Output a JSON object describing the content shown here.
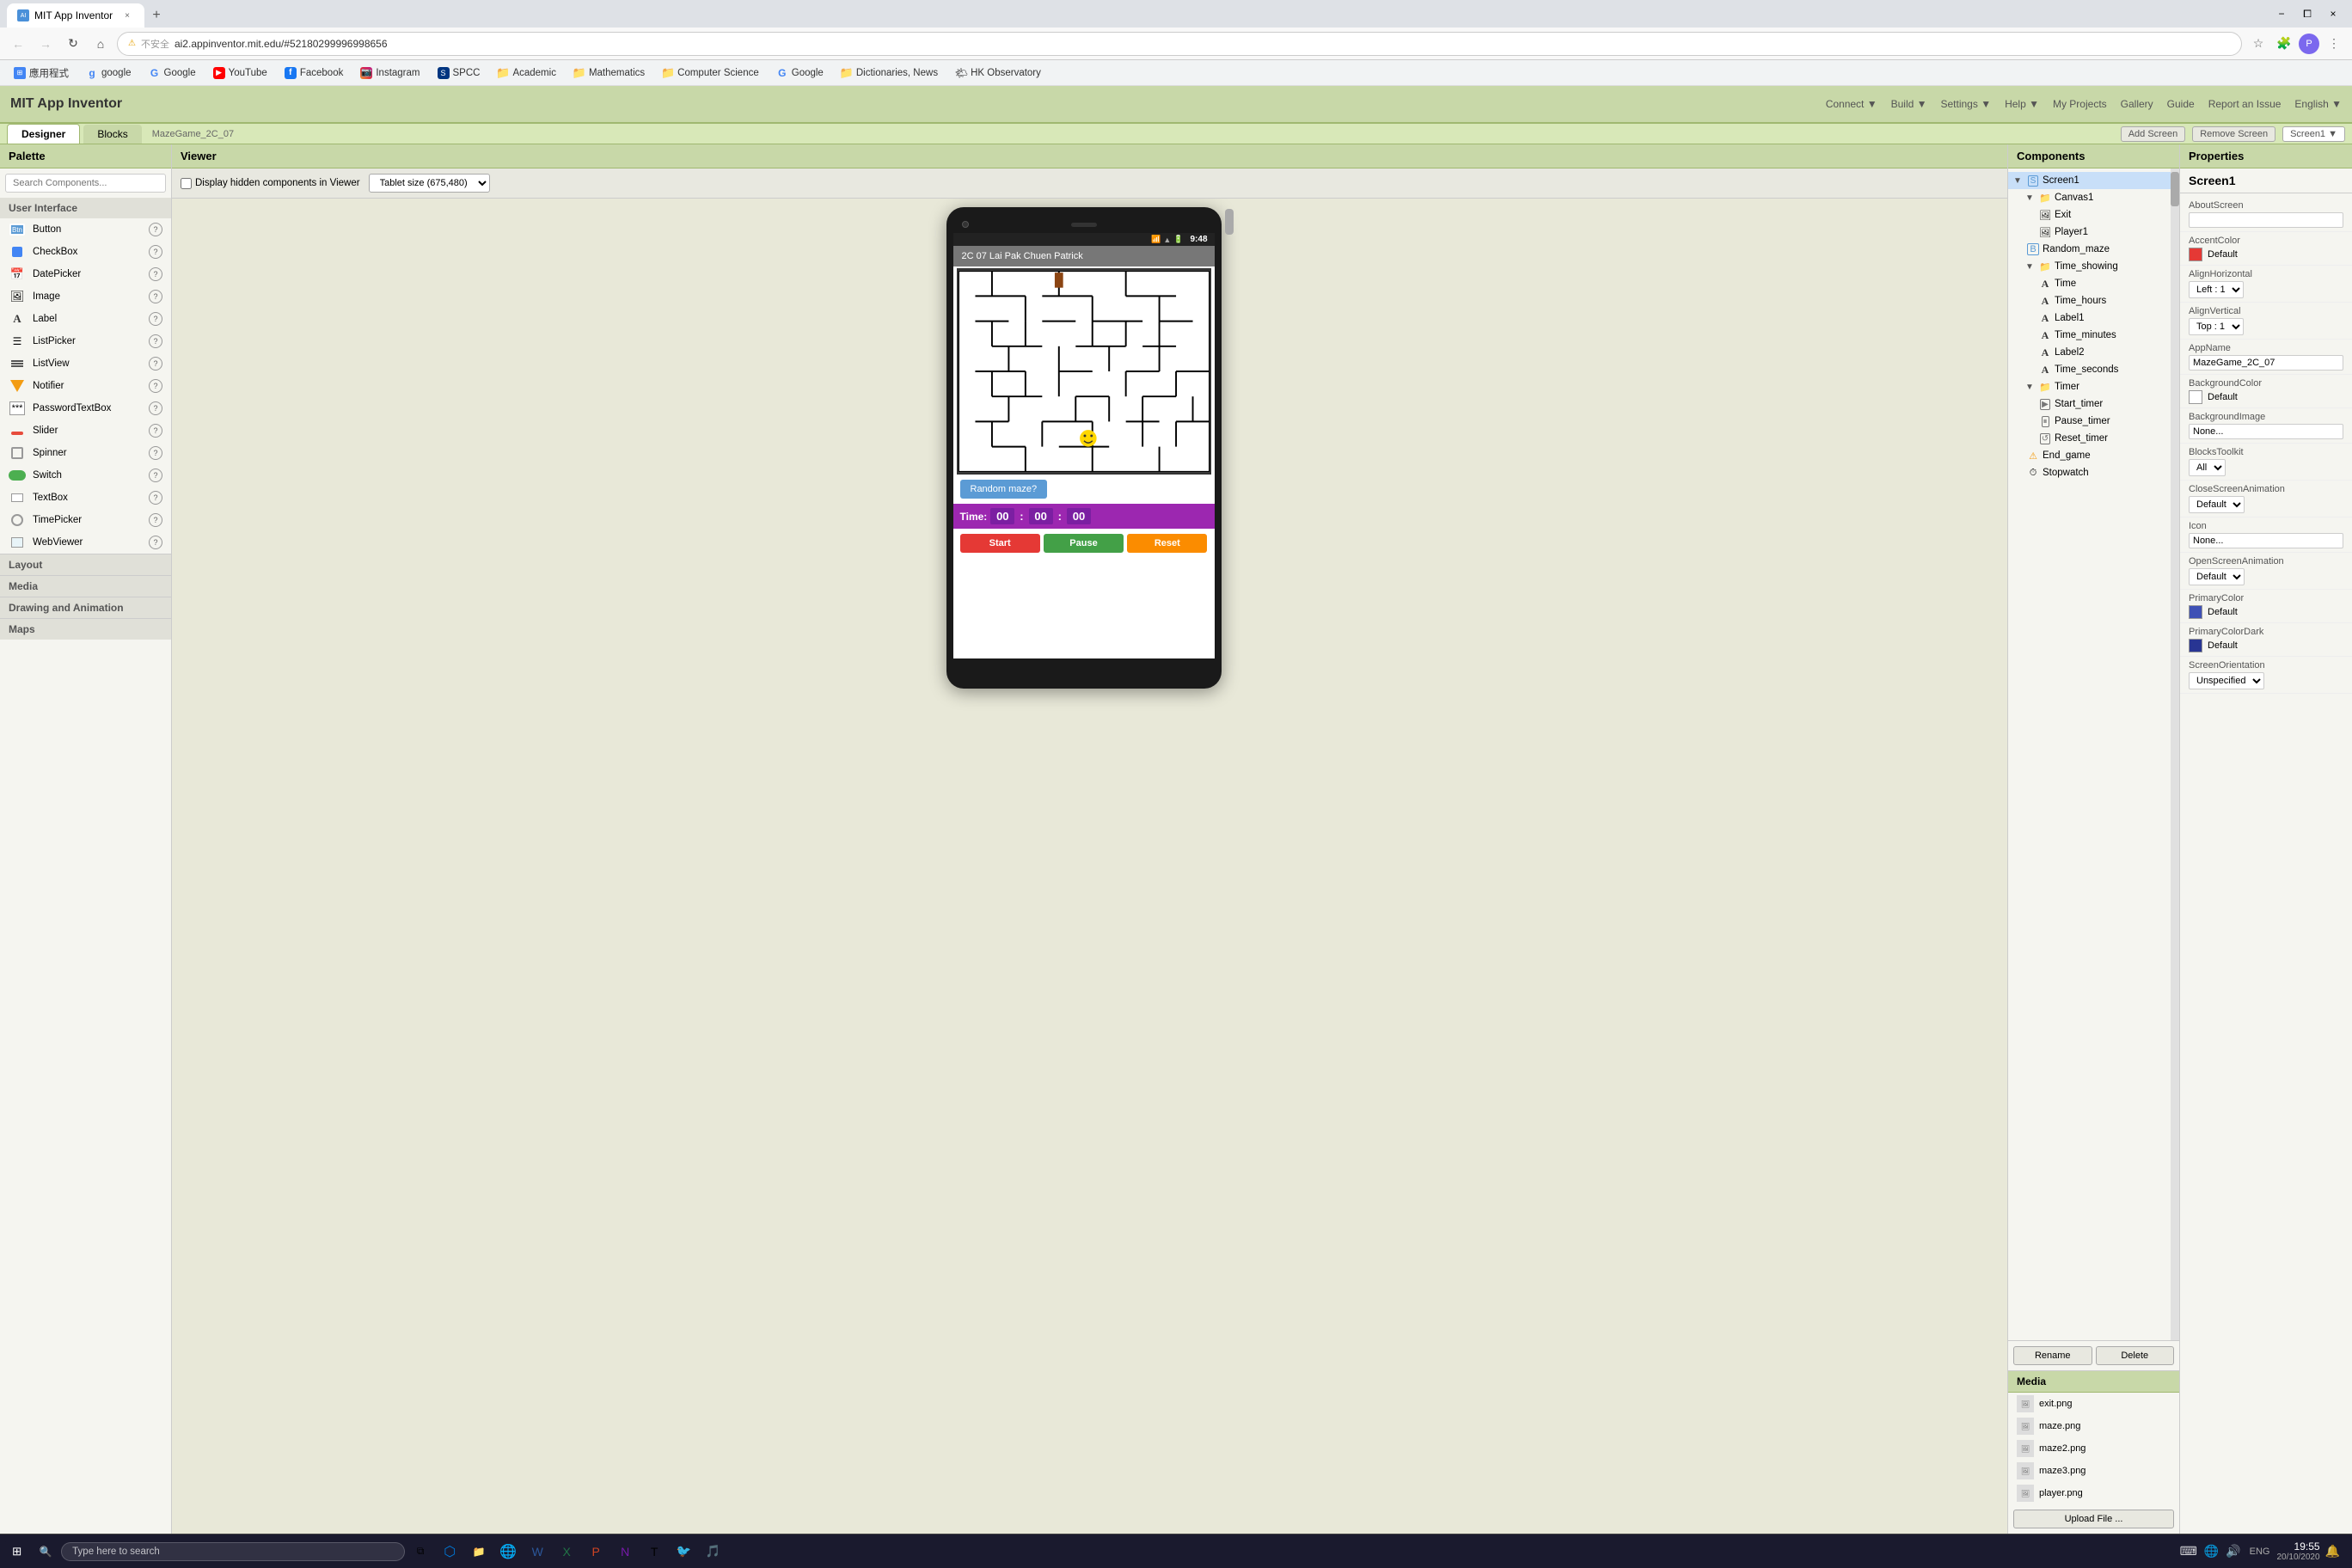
{
  "browser": {
    "tab": {
      "favicon": "MIT",
      "title": "MIT App Inventor",
      "url": "ai2.appinventor.mit.edu/#52180299996998656",
      "url_display": "ai2.appinventor.mit.edu/#52180299996998656",
      "security_label": "不安全",
      "close_label": "×"
    },
    "new_tab_label": "+",
    "window_controls": {
      "minimize": "−",
      "maximize": "⧠",
      "close": "×"
    },
    "bookmarks": [
      {
        "id": "apps",
        "label": "應用程式",
        "icon": "grid"
      },
      {
        "id": "google-lower",
        "label": "google",
        "icon": "g"
      },
      {
        "id": "google-upper",
        "label": "Google",
        "icon": "G"
      },
      {
        "id": "youtube",
        "label": "YouTube",
        "icon": "YT"
      },
      {
        "id": "facebook",
        "label": "Facebook",
        "icon": "f"
      },
      {
        "id": "instagram",
        "label": "Instagram",
        "icon": "in"
      },
      {
        "id": "spcc",
        "label": "SPCC",
        "icon": "S"
      },
      {
        "id": "academic",
        "label": "Academic",
        "icon": "📁"
      },
      {
        "id": "mathematics",
        "label": "Mathematics",
        "icon": "📁"
      },
      {
        "id": "computer-science",
        "label": "Computer Science",
        "icon": "📁"
      },
      {
        "id": "google-bm",
        "label": "Google",
        "icon": "G"
      },
      {
        "id": "dictionaries",
        "label": "Dictionaries, News",
        "icon": "📁"
      },
      {
        "id": "hk-observatory",
        "label": "HK Observatory",
        "icon": "🌤"
      }
    ]
  },
  "app_header": {
    "title": "MIT App Inventor"
  },
  "palette": {
    "header": "Palette",
    "search_placeholder": "Search Components...",
    "sections": [
      {
        "id": "user-interface",
        "title": "User Interface",
        "items": [
          {
            "id": "button",
            "label": "Button"
          },
          {
            "id": "checkbox",
            "label": "CheckBox"
          },
          {
            "id": "datepicker",
            "label": "DatePicker"
          },
          {
            "id": "image",
            "label": "Image"
          },
          {
            "id": "label",
            "label": "Label"
          },
          {
            "id": "listpicker",
            "label": "ListPicker"
          },
          {
            "id": "listview",
            "label": "ListView"
          },
          {
            "id": "notifier",
            "label": "Notifier"
          },
          {
            "id": "passwordtextbox",
            "label": "PasswordTextBox"
          },
          {
            "id": "slider",
            "label": "Slider"
          },
          {
            "id": "spinner",
            "label": "Spinner"
          },
          {
            "id": "switch",
            "label": "Switch"
          },
          {
            "id": "textbox",
            "label": "TextBox"
          },
          {
            "id": "timepicker",
            "label": "TimePicker"
          },
          {
            "id": "webviewer",
            "label": "WebViewer"
          }
        ]
      },
      {
        "id": "layout",
        "title": "Layout"
      },
      {
        "id": "media",
        "title": "Media"
      },
      {
        "id": "drawing",
        "title": "Drawing and Animation"
      },
      {
        "id": "maps",
        "title": "Maps"
      }
    ]
  },
  "viewer": {
    "header": "Viewer",
    "checkbox_label": "Display hidden components in Viewer",
    "size_label": "Tablet size (675,480)",
    "app_title_bar": "2C 07 Lai Pak Chuen Patrick",
    "random_btn": "Random maze?",
    "timer": {
      "label": "Time:",
      "hours": "00",
      "minutes": "00",
      "seconds": "00"
    },
    "controls": {
      "start": "Start",
      "pause": "Pause",
      "reset": "Reset"
    },
    "phone_status": {
      "time": "9:48"
    }
  },
  "components": {
    "header": "Components",
    "tree": [
      {
        "id": "screen1",
        "label": "Screen1",
        "level": 0,
        "type": "screen",
        "expanded": true,
        "selected": true
      },
      {
        "id": "canvas1",
        "label": "Canvas1",
        "level": 1,
        "type": "canvas",
        "expanded": true
      },
      {
        "id": "exit",
        "label": "Exit",
        "level": 2,
        "type": "image"
      },
      {
        "id": "player1",
        "label": "Player1",
        "level": 2,
        "type": "image"
      },
      {
        "id": "random_maze",
        "label": "Random_maze",
        "level": 1,
        "type": "button"
      },
      {
        "id": "time_showing",
        "label": "Time_showing",
        "level": 1,
        "type": "table",
        "expanded": true
      },
      {
        "id": "time",
        "label": "Time",
        "level": 2,
        "type": "label"
      },
      {
        "id": "time_hours",
        "label": "Time_hours",
        "level": 2,
        "type": "label"
      },
      {
        "id": "label1",
        "label": "Label1",
        "level": 2,
        "type": "label"
      },
      {
        "id": "time_minutes",
        "label": "Time_minutes",
        "level": 2,
        "type": "label"
      },
      {
        "id": "label2",
        "label": "Label2",
        "level": 2,
        "type": "label"
      },
      {
        "id": "time_seconds",
        "label": "Time_seconds",
        "level": 2,
        "type": "label"
      },
      {
        "id": "timer",
        "label": "Timer",
        "level": 1,
        "type": "table",
        "expanded": true
      },
      {
        "id": "start_timer",
        "label": "Start_timer",
        "level": 2,
        "type": "button-sm"
      },
      {
        "id": "pause_timer",
        "label": "Pause_timer",
        "level": 2,
        "type": "button-sm"
      },
      {
        "id": "reset_timer",
        "label": "Reset_timer",
        "level": 2,
        "type": "button-sm"
      },
      {
        "id": "end_game",
        "label": "End_game",
        "level": 1,
        "type": "notifier"
      },
      {
        "id": "stopwatch",
        "label": "Stopwatch",
        "level": 1,
        "type": "clock"
      }
    ],
    "rename_btn": "Rename",
    "delete_btn": "Delete"
  },
  "media": {
    "header": "Media",
    "files": [
      {
        "id": "exit-png",
        "label": "exit.png"
      },
      {
        "id": "maze-png",
        "label": "maze.png"
      },
      {
        "id": "maze2-png",
        "label": "maze2.png"
      },
      {
        "id": "maze3-png",
        "label": "maze3.png"
      },
      {
        "id": "player-png",
        "label": "player.png"
      }
    ],
    "upload_btn": "Upload File ..."
  },
  "properties": {
    "header": "Properties",
    "component_name": "Screen1",
    "items": [
      {
        "id": "aboutscreen",
        "label": "AboutScreen",
        "type": "input",
        "value": ""
      },
      {
        "id": "accentcolor",
        "label": "AccentColor",
        "type": "color",
        "color": "#e53935",
        "value": "Default"
      },
      {
        "id": "alignhorizontal",
        "label": "AlignHorizontal",
        "type": "select",
        "value": "Left : 1"
      },
      {
        "id": "alignvertical",
        "label": "AlignVertical",
        "type": "select",
        "value": "Top : 1"
      },
      {
        "id": "appname",
        "label": "AppName",
        "type": "input",
        "value": "MazeGame_2C_07"
      },
      {
        "id": "backgroundcolor",
        "label": "BackgroundColor",
        "type": "color",
        "color": "#ffffff",
        "value": "Default"
      },
      {
        "id": "backgroundimage",
        "label": "BackgroundImage",
        "type": "input",
        "value": "None..."
      },
      {
        "id": "blockstoolkit",
        "label": "BlocksToolkit",
        "type": "select",
        "value": "All"
      },
      {
        "id": "closescreenanimation",
        "label": "CloseScreenAnimation",
        "type": "select",
        "value": "Default"
      },
      {
        "id": "icon",
        "label": "Icon",
        "type": "input",
        "value": "None..."
      },
      {
        "id": "openscreenanimation",
        "label": "OpenScreenAnimation",
        "type": "select",
        "value": "Default"
      },
      {
        "id": "primarycolor",
        "label": "PrimaryColor",
        "type": "color",
        "color": "#3f51b5",
        "value": "Default"
      },
      {
        "id": "primarycolordark",
        "label": "PrimaryColorDark",
        "type": "color",
        "color": "#283593",
        "value": "Default"
      },
      {
        "id": "screenorientation",
        "label": "ScreenOrientation",
        "type": "select",
        "value": "Unspecified"
      }
    ]
  },
  "taskbar": {
    "start_icon": "⊞",
    "search_placeholder": "Type here to search",
    "time": "19:55",
    "date": "20/10/2020",
    "lang": "ENG",
    "notification_icon": "🔔"
  }
}
